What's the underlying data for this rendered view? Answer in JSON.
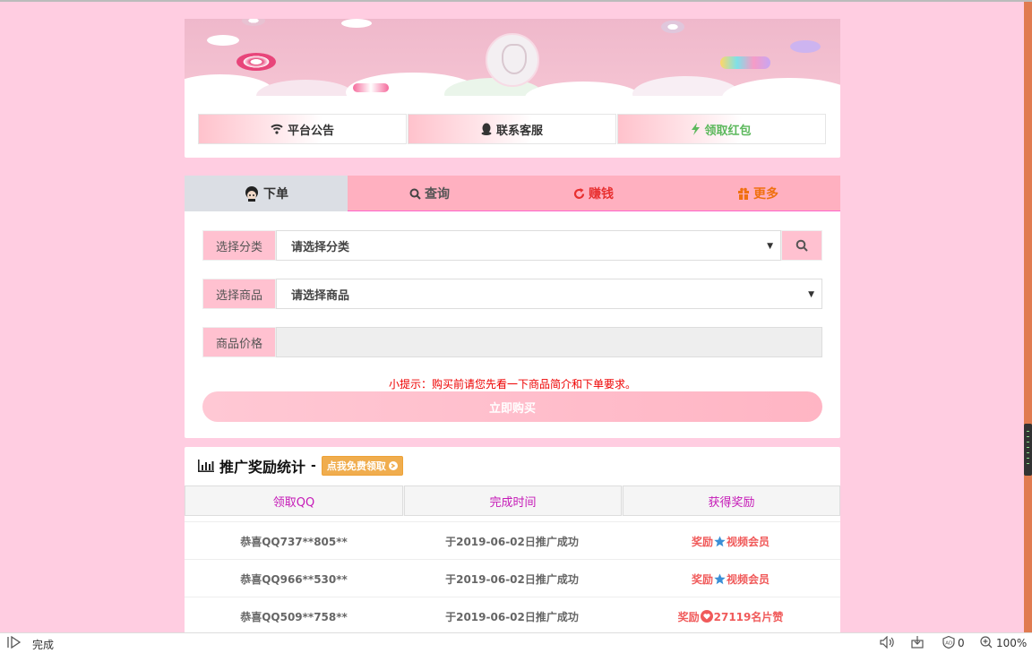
{
  "links": [
    {
      "label": "平台公告",
      "icon": "wifi-icon"
    },
    {
      "label": "联系客服",
      "icon": "qq-penguin-icon"
    },
    {
      "label": "领取红包",
      "icon": "bolt-icon"
    }
  ],
  "tabs": [
    {
      "label": "下单",
      "icon": "cartoon-avatar-icon"
    },
    {
      "label": "查询",
      "icon": "search-icon"
    },
    {
      "label": "赚钱",
      "icon": "refresh-icon"
    },
    {
      "label": "更多",
      "icon": "gift-icon"
    }
  ],
  "form": {
    "category_label": "选择分类",
    "category_value": "请选择分类",
    "product_label": "选择商品",
    "product_value": "请选择商品",
    "price_label": "商品价格",
    "price_value": "",
    "tip": "小提示：购买前请您先看一下商品简介和下单要求。",
    "buy_label": "立即购买"
  },
  "stats": {
    "title": "推广奖励统计",
    "dash": "-",
    "badge": "点我免费领取",
    "columns": [
      "领取QQ",
      "完成时间",
      "获得奖励"
    ],
    "rows": [
      {
        "qq": "恭喜QQ737**805**",
        "time": "于2019-06-02日推广成功",
        "reward_prefix": "奖励",
        "reward": "视频会员",
        "reward_icon": "star-icon"
      },
      {
        "qq": "恭喜QQ966**530**",
        "time": "于2019-06-02日推广成功",
        "reward_prefix": "奖励",
        "reward": "视频会员",
        "reward_icon": "star-icon"
      },
      {
        "qq": "恭喜QQ509**758**",
        "time": "于2019-06-02日推广成功",
        "reward_prefix": "奖励",
        "reward": "27119名片赞",
        "reward_icon": "heart-icon"
      }
    ]
  },
  "statusbar": {
    "status": "完成",
    "ad_count": "0",
    "zoom": "100%"
  },
  "colors": {
    "page_bg": "#ffcde1",
    "accent_pink": "#ffb0c0",
    "tip_red": "#e00000",
    "header_magenta": "#c51ab7",
    "reward_red": "#f05a5a"
  }
}
